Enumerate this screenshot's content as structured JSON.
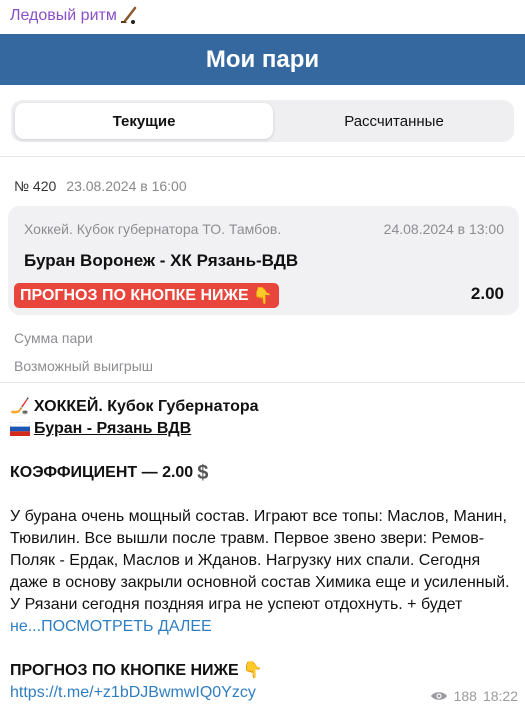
{
  "channel": {
    "name": "Ледовый ритм",
    "icon": "hockey-stick-icon"
  },
  "banner": {
    "title": "Мои пари"
  },
  "tabs": [
    {
      "label": "Текущие",
      "active": true
    },
    {
      "label": "Рассчитанные",
      "active": false
    }
  ],
  "bet": {
    "number": "№ 420",
    "date": "23.08.2024 в 16:00",
    "league": "Хоккей. Кубок губернатора ТО. Тамбов.",
    "match_date": "24.08.2024 в 13:00",
    "teams": "Буран Воронеж - ХК Рязань-ВДВ",
    "badge": "ПРОГНОЗ ПО КНОПКЕ НИЖЕ",
    "odds": "2.00",
    "sum_label": "Сумма пари",
    "win_label": "Возможный выигрыш"
  },
  "message": {
    "line1": "ХОККЕЙ. Кубок Губернатора",
    "line2": "Буран - Рязань ВДВ",
    "coef": "КОЭФФИЦИЕНТ — 2.00",
    "body": "У бурана очень мощный состав. Играют все топы: Маслов, Манин, Тювилин. Все вышли после травм. Первое звено звери: Ремов- Поляк - Ердак, Маслов и Жданов. Нагрузку них спали. Сегодня даже в основу закрыли основной состав Химика еще и усиленный. У Рязани сегодня поздняя игра не успеют отдохнуть. + будет ",
    "more": "не...ПОСМОТРЕТЬ ДАЛЕЕ",
    "cta": "ПРОГНОЗ ПО КНОПКЕ НИЖЕ",
    "link": "https://t.me/+z1bDJBwmwIQ0Yzcy"
  },
  "footer": {
    "views": "188",
    "time": "18:22"
  },
  "colors": {
    "banner": "#35689f",
    "badge": "#e8453c",
    "link": "#2f7ec2",
    "channel": "#8a4fc7"
  }
}
